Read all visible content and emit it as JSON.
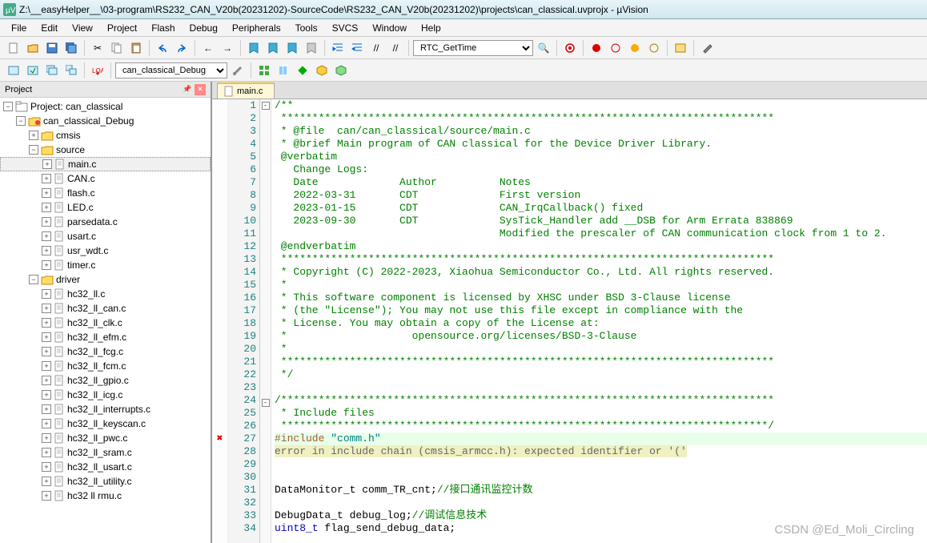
{
  "title": "Z:\\__easyHelper__\\03-program\\RS232_CAN_V20b(20231202)-SourceCode\\RS232_CAN_V20b(20231202)\\projects\\can_classical.uvprojx - µVision",
  "menu": [
    "File",
    "Edit",
    "View",
    "Project",
    "Flash",
    "Debug",
    "Peripherals",
    "Tools",
    "SVCS",
    "Window",
    "Help"
  ],
  "toolbar": {
    "combo1": "RTC_GetTime",
    "target_combo": "can_classical_Debug"
  },
  "project_pane": {
    "title": "Project",
    "root": "Project: can_classical",
    "target": "can_classical_Debug",
    "groups": [
      {
        "name": "cmsis",
        "expanded": false
      },
      {
        "name": "source",
        "expanded": true,
        "files": [
          "main.c",
          "CAN.c",
          "flash.c",
          "LED.c",
          "parsedata.c",
          "usart.c",
          "usr_wdt.c",
          "timer.c"
        ]
      },
      {
        "name": "driver",
        "expanded": true,
        "files": [
          "hc32_ll.c",
          "hc32_ll_can.c",
          "hc32_ll_clk.c",
          "hc32_ll_efm.c",
          "hc32_ll_fcg.c",
          "hc32_ll_fcm.c",
          "hc32_ll_gpio.c",
          "hc32_ll_icg.c",
          "hc32_ll_interrupts.c",
          "hc32_ll_keyscan.c",
          "hc32_ll_pwc.c",
          "hc32_ll_sram.c",
          "hc32_ll_usart.c",
          "hc32_ll_utility.c",
          "hc32 ll rmu.c"
        ]
      }
    ]
  },
  "editor": {
    "tab": "main.c",
    "lines": [
      {
        "n": 1,
        "fold": "-",
        "cls": "c-comment",
        "text": "/**"
      },
      {
        "n": 2,
        "cls": "c-comment",
        "text": " *******************************************************************************"
      },
      {
        "n": 3,
        "cls": "c-comment",
        "text": " * @file  can/can_classical/source/main.c"
      },
      {
        "n": 4,
        "cls": "c-comment",
        "text": " * @brief Main program of CAN classical for the Device Driver Library."
      },
      {
        "n": 5,
        "cls": "c-comment",
        "text": " @verbatim"
      },
      {
        "n": 6,
        "cls": "c-comment",
        "text": "   Change Logs:"
      },
      {
        "n": 7,
        "cls": "c-comment",
        "text": "   Date             Author          Notes"
      },
      {
        "n": 8,
        "cls": "c-comment",
        "text": "   2022-03-31       CDT             First version"
      },
      {
        "n": 9,
        "cls": "c-comment",
        "text": "   2023-01-15       CDT             CAN_IrqCallback() fixed"
      },
      {
        "n": 10,
        "cls": "c-comment",
        "text": "   2023-09-30       CDT             SysTick_Handler add __DSB for Arm Errata 838869"
      },
      {
        "n": 11,
        "cls": "c-comment",
        "text": "                                    Modified the prescaler of CAN communication clock from 1 to 2."
      },
      {
        "n": 12,
        "cls": "c-comment",
        "text": " @endverbatim"
      },
      {
        "n": 13,
        "cls": "c-comment",
        "text": " *******************************************************************************"
      },
      {
        "n": 14,
        "cls": "c-comment",
        "text": " * Copyright (C) 2022-2023, Xiaohua Semiconductor Co., Ltd. All rights reserved."
      },
      {
        "n": 15,
        "cls": "c-comment",
        "text": " *"
      },
      {
        "n": 16,
        "cls": "c-comment",
        "text": " * This software component is licensed by XHSC under BSD 3-Clause license"
      },
      {
        "n": 17,
        "cls": "c-comment",
        "text": " * (the \"License\"); You may not use this file except in compliance with the"
      },
      {
        "n": 18,
        "cls": "c-comment",
        "text": " * License. You may obtain a copy of the License at:"
      },
      {
        "n": 19,
        "cls": "c-comment",
        "text": " *                    opensource.org/licenses/BSD-3-Clause"
      },
      {
        "n": 20,
        "cls": "c-comment",
        "text": " *"
      },
      {
        "n": 21,
        "cls": "c-comment",
        "text": " *******************************************************************************"
      },
      {
        "n": 22,
        "cls": "c-comment",
        "text": " */"
      },
      {
        "n": 23,
        "text": ""
      },
      {
        "n": 24,
        "fold": "-",
        "cls": "c-comment",
        "text": "/*******************************************************************************"
      },
      {
        "n": 25,
        "cls": "c-comment",
        "text": " * Include files"
      },
      {
        "n": 26,
        "cls": "c-comment",
        "text": " ******************************************************************************/"
      },
      {
        "n": 27,
        "err": true,
        "hl": true,
        "html": "<span class='c-include'>#include </span><span class='c-string'>\"comm.h\"</span>"
      },
      {
        "n": 28,
        "html": "<span class='c-err'>error in include chain (cmsis_armcc.h): expected identifier or '('</span>"
      },
      {
        "n": 29,
        "text": ""
      },
      {
        "n": 30,
        "text": ""
      },
      {
        "n": 31,
        "html": "DataMonitor_t comm_TR_cnt;<span class='c-cn'>//接口通讯监控计数</span>"
      },
      {
        "n": 32,
        "text": ""
      },
      {
        "n": 33,
        "html": "DebugData_t debug_log;<span class='c-cn'>//调试信息技术</span>"
      },
      {
        "n": 34,
        "html": "<span class='c-type'>uint8_t</span> flag_send_debug_data;"
      }
    ]
  },
  "watermark": "CSDN @Ed_Moli_Circling"
}
